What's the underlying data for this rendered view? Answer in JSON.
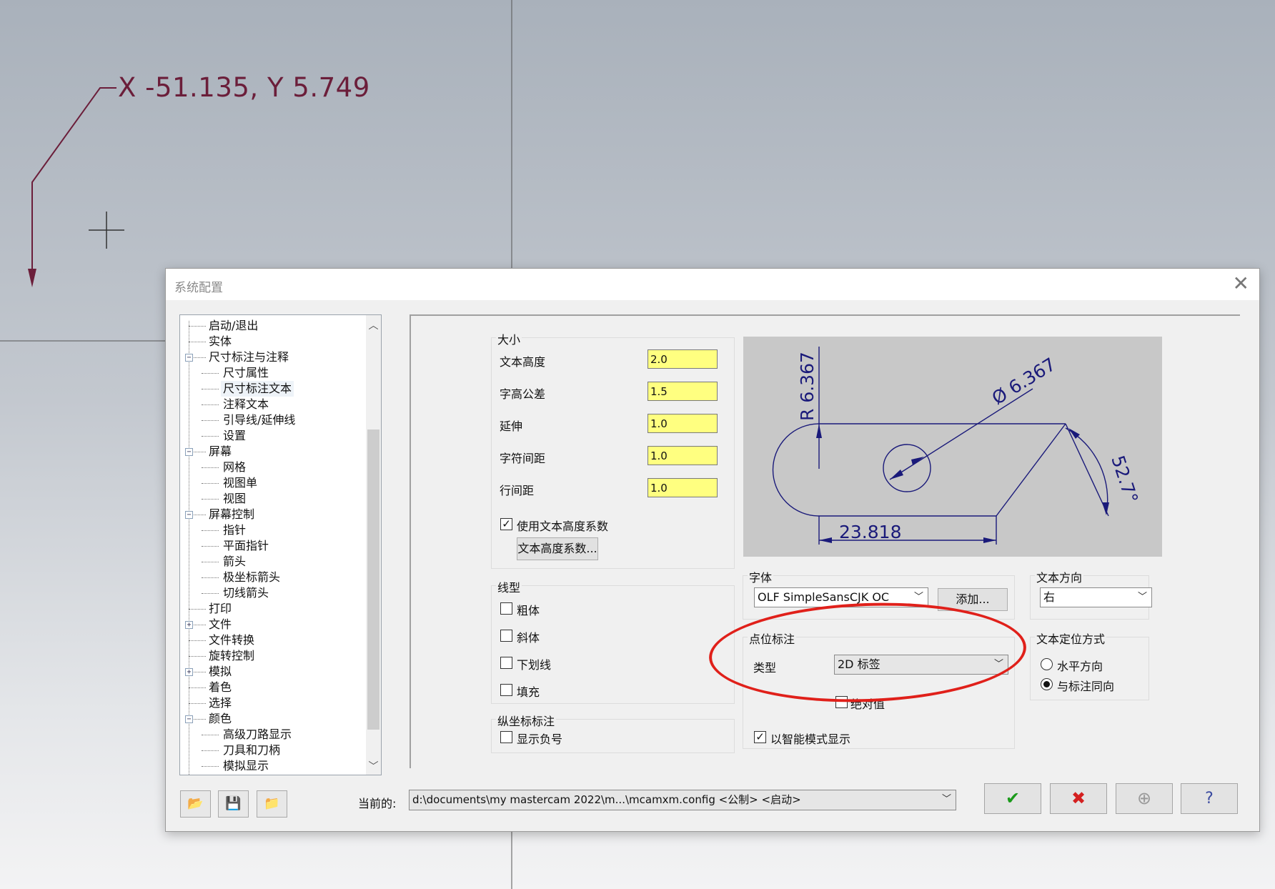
{
  "canvas": {
    "coord_readout": "X -51.135, Y 5.749",
    "curve_color": "#6b1e3a"
  },
  "dialog": {
    "title": "系统配置",
    "close_icon": "close-icon"
  },
  "tree": {
    "items": [
      {
        "label": "启动/退出",
        "level": 0,
        "expander": ""
      },
      {
        "label": "实体",
        "level": 0,
        "expander": ""
      },
      {
        "label": "尺寸标注与注释",
        "level": 0,
        "expander": "−"
      },
      {
        "label": "尺寸属性",
        "level": 1,
        "expander": ""
      },
      {
        "label": "尺寸标注文本",
        "level": 1,
        "expander": "",
        "selected": true
      },
      {
        "label": "注释文本",
        "level": 1,
        "expander": ""
      },
      {
        "label": "引导线/延伸线",
        "level": 1,
        "expander": ""
      },
      {
        "label": "设置",
        "level": 1,
        "expander": ""
      },
      {
        "label": "屏幕",
        "level": 0,
        "expander": "−"
      },
      {
        "label": "网格",
        "level": 1,
        "expander": ""
      },
      {
        "label": "视图单",
        "level": 1,
        "expander": ""
      },
      {
        "label": "视图",
        "level": 1,
        "expander": ""
      },
      {
        "label": "屏幕控制",
        "level": 0,
        "expander": "−"
      },
      {
        "label": "指针",
        "level": 1,
        "expander": ""
      },
      {
        "label": "平面指针",
        "level": 1,
        "expander": ""
      },
      {
        "label": "箭头",
        "level": 1,
        "expander": ""
      },
      {
        "label": "极坐标箭头",
        "level": 1,
        "expander": ""
      },
      {
        "label": "切线箭头",
        "level": 1,
        "expander": ""
      },
      {
        "label": "打印",
        "level": 0,
        "expander": ""
      },
      {
        "label": "文件",
        "level": 0,
        "expander": "+"
      },
      {
        "label": "文件转换",
        "level": 0,
        "expander": ""
      },
      {
        "label": "旋转控制",
        "level": 0,
        "expander": ""
      },
      {
        "label": "模拟",
        "level": 0,
        "expander": "+"
      },
      {
        "label": "着色",
        "level": 0,
        "expander": ""
      },
      {
        "label": "选择",
        "level": 0,
        "expander": ""
      },
      {
        "label": "颜色",
        "level": 0,
        "expander": "−"
      },
      {
        "label": "高级刀路显示",
        "level": 1,
        "expander": ""
      },
      {
        "label": "刀具和刀柄",
        "level": 1,
        "expander": ""
      },
      {
        "label": "模拟显示",
        "level": 1,
        "expander": ""
      }
    ]
  },
  "size_group": {
    "title": "大小",
    "fields": [
      {
        "label": "文本高度",
        "value": "2.0"
      },
      {
        "label": "字高公差",
        "value": "1.5"
      },
      {
        "label": "延伸",
        "value": "1.0"
      },
      {
        "label": "字符间距",
        "value": "1.0"
      },
      {
        "label": "行间距",
        "value": "1.0"
      }
    ],
    "use_height_factor_label": "使用文本高度系数",
    "use_height_factor_checked": true,
    "height_factor_button": "文本高度系数..."
  },
  "line_type": {
    "title": "线型",
    "options": [
      {
        "label": "粗体",
        "checked": false
      },
      {
        "label": "斜体",
        "checked": false
      },
      {
        "label": "下划线",
        "checked": false
      },
      {
        "label": "填充",
        "checked": false
      }
    ]
  },
  "ordinate": {
    "title": "纵坐标标注",
    "show_negative_label": "显示负号",
    "show_negative_checked": false
  },
  "preview": {
    "radius_label": "R 6.367",
    "diameter_label": "Ø 6.367",
    "angle_label": "52.7°",
    "length_label": "23.818",
    "line_color": "#1a1a7a"
  },
  "font_group": {
    "title": "字体",
    "selected_font": "OLF SimpleSansCJK OC",
    "add_button": "添加..."
  },
  "point_dim": {
    "title": "点位标注",
    "type_label": "类型",
    "type_value": "2D 标签",
    "absolute_label": "绝对值",
    "absolute_checked": false
  },
  "smart_mode": {
    "label": "以智能模式显示",
    "checked": true
  },
  "text_direction": {
    "title": "文本方向",
    "value": "右"
  },
  "text_positioning": {
    "title": "文本定位方式",
    "options": [
      {
        "label": "水平方向",
        "selected": false
      },
      {
        "label": "与标注同向",
        "selected": true
      }
    ]
  },
  "footer": {
    "current_label": "当前的:",
    "current_path": "d:\\documents\\my mastercam 2022\\m...\\mcamxm.config <公制> <启动>",
    "ok_color": "#1a9a1a",
    "cancel_color": "#d42020"
  },
  "annotation": {
    "ellipse_color": "#e0201a"
  }
}
